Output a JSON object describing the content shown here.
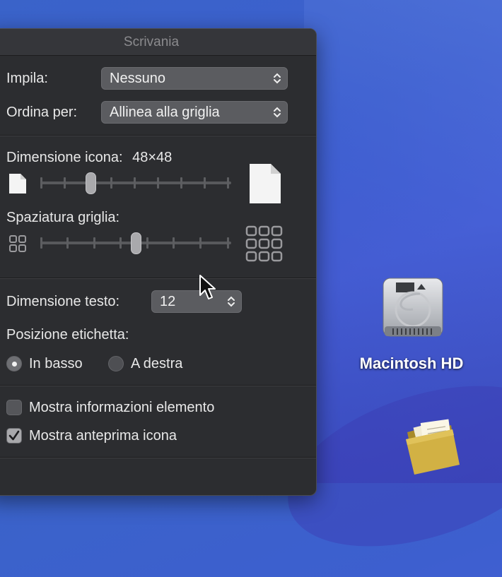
{
  "window": {
    "title": "Scrivania"
  },
  "stack": {
    "label": "Impila:",
    "value": "Nessuno"
  },
  "sort": {
    "label": "Ordina per:",
    "value": "Allinea alla griglia"
  },
  "icon_size": {
    "label": "Dimensione icona:",
    "value": "48×48",
    "level": 0.25
  },
  "grid_spacing": {
    "label": "Spaziatura griglia:",
    "level": 0.5
  },
  "text_size": {
    "label": "Dimensione testo:",
    "value": "12"
  },
  "label_position": {
    "label": "Posizione etichetta:",
    "options": [
      "In basso",
      "A destra"
    ],
    "selected": "In basso"
  },
  "show_item_info": {
    "label": "Mostra informazioni elemento",
    "checked": false
  },
  "show_icon_preview": {
    "label": "Mostra anteprima icona",
    "checked": true
  },
  "desktop": {
    "drive_name": "Macintosh HD"
  },
  "icons": {
    "small_doc": "document-small-icon",
    "large_doc": "document-large-icon",
    "small_grid": "grid-small-icon",
    "large_grid": "grid-large-icon",
    "drive": "hard-drive-icon",
    "folder": "folder-icon",
    "cursor": "mouse-pointer-icon"
  }
}
